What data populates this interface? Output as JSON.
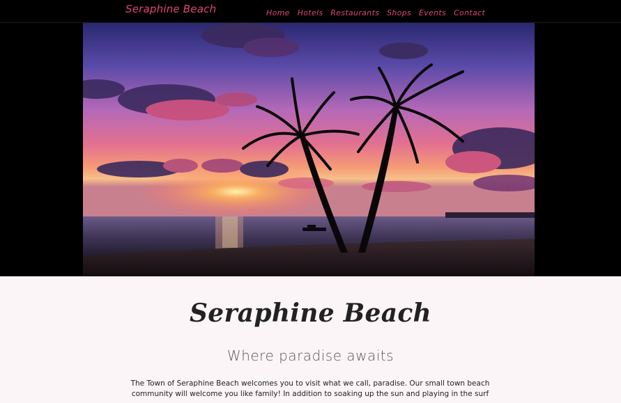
{
  "site": {
    "brand": "Seraphine Beach"
  },
  "nav": {
    "items": [
      {
        "label": "Home"
      },
      {
        "label": "Hotels"
      },
      {
        "label": "Restaurants"
      },
      {
        "label": "Shops"
      },
      {
        "label": "Events"
      },
      {
        "label": "Contact"
      }
    ]
  },
  "hero": {
    "image": "palm-trees-sunset-beach-photo"
  },
  "main": {
    "title": "Seraphine Beach",
    "tagline": "Where paradise awaits",
    "intro": "The Town of Seraphine Beach welcomes you to visit what we call, paradise. Our small town beach community will welcome you like family! In addition to soaking up the sun and playing in the surf"
  },
  "colors": {
    "accent": "#e0457a",
    "page_bg": "#fbf5f7",
    "header_bg": "#000000"
  }
}
